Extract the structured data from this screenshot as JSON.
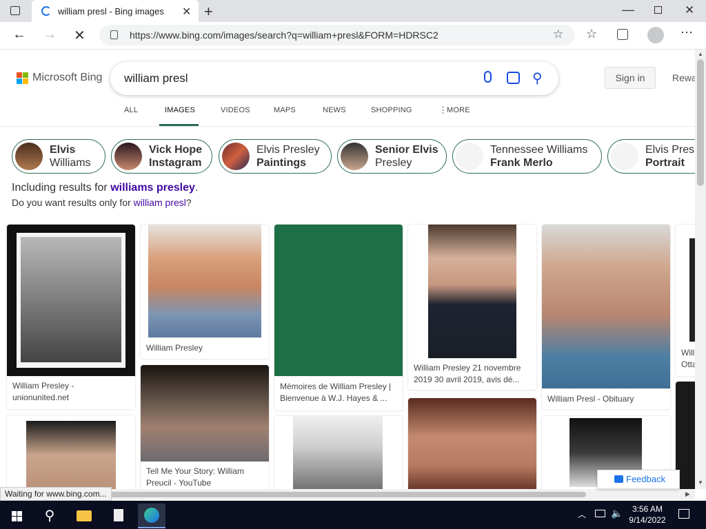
{
  "browser": {
    "tab_title": "william presl - Bing images",
    "url": "https://www.bing.com/images/search?q=william+presl&FORM=HDRSC2",
    "status_text": "Waiting for www.bing.com..."
  },
  "bing": {
    "logo_text": "Microsoft Bing",
    "query": "william presl",
    "sign_in": "Sign in",
    "rewards": "Rewa",
    "nav": [
      "ALL",
      "IMAGES",
      "VIDEOS",
      "MAPS",
      "NEWS",
      "SHOPPING",
      "MORE"
    ],
    "active_nav": "IMAGES"
  },
  "chips": [
    {
      "line1": "Elvis",
      "line2": "Williams"
    },
    {
      "line1": "Vick Hope",
      "line2": "Instagram"
    },
    {
      "line1": "Elvis Presley",
      "line2": "Paintings"
    },
    {
      "line1": "Senior Elvis",
      "line2": "Presley"
    },
    {
      "line1": "Tennessee Williams",
      "line2": "Frank Merlo"
    },
    {
      "line1": "Elvis Presl",
      "line2": "Portrait"
    }
  ],
  "correction": {
    "including_prefix": "Including results for ",
    "including_link": "williams presley",
    "including_suffix": ".",
    "want_prefix": "Do you want results only for ",
    "want_link": "william presl",
    "want_suffix": "?"
  },
  "results": [
    {
      "caption": "William Presley - unionunited.net"
    },
    {
      "caption": "William Presley"
    },
    {
      "caption": "Mémoires de William Presley | Bienvenue à W.J. Hayes & ..."
    },
    {
      "caption": "William Presley 21 novembre 2019 30 avril 2019, avis dé..."
    },
    {
      "caption": "William Presl - Obituary"
    },
    {
      "caption": "Tell Me Your Story: William Preucil - YouTube"
    },
    {
      "caption": "Will Otta"
    }
  ],
  "feedback": "Feedback",
  "taskbar": {
    "time": "3:56 AM",
    "date": "9/14/2022"
  },
  "colors": {
    "bing_blue": "#174ae4",
    "accent_teal": "#2b6b5a",
    "link_purple": "#4007a2"
  }
}
